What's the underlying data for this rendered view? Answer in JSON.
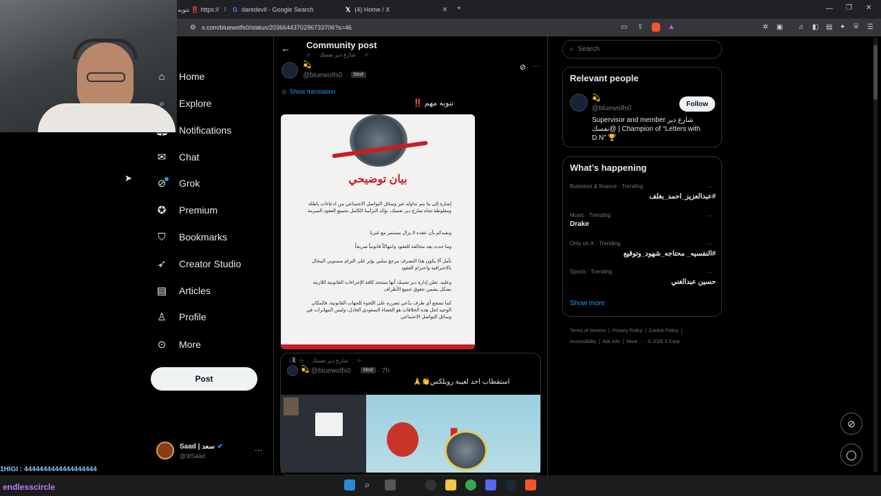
{
  "browser": {
    "tabs": [
      {
        "label": "تنويه ‼️ https://"
      },
      {
        "label": "daredevil - Google Search"
      },
      {
        "label": "(4) Home / X"
      }
    ],
    "url": "x.com/bluewolfs0/status/2036644370296733706?s=46"
  },
  "nav": {
    "items": [
      {
        "label": "Home",
        "icon": "home-icon"
      },
      {
        "label": "Explore",
        "icon": "search-icon"
      },
      {
        "label": "Notifications",
        "icon": "bell-icon"
      },
      {
        "label": "Chat",
        "icon": "mail-icon"
      },
      {
        "label": "Grok",
        "icon": "grok-icon"
      },
      {
        "label": "Premium",
        "icon": "verified-icon"
      },
      {
        "label": "Bookmarks",
        "icon": "bookmark-icon"
      },
      {
        "label": "Creator Studio",
        "icon": "rocket-icon"
      },
      {
        "label": "Articles",
        "icon": "article-icon"
      },
      {
        "label": "Profile",
        "icon": "person-icon"
      },
      {
        "label": "More",
        "icon": "more-circle-icon"
      }
    ],
    "post_label": "Post",
    "account": {
      "name": "Saad | سعد",
      "handle": "@9lSaad"
    }
  },
  "header": {
    "title": "Community post",
    "subtitle": "⊹ ﹒ شارع دير نفسك ﹒ ⊹"
  },
  "post": {
    "author_emoji": "💫",
    "handle": "@bluewolfs0",
    "mod": "Mod",
    "show_translation": "Show translation",
    "text": "تنويه مهم ‼️",
    "image_title": "بيان توضيحي",
    "image_paragraphs": [
      "إشارة إلى ما يتم تداوله عبر وسائل التواصل الاجتماعي من ادعاءات باطلة ومغلوطة تجاه شارع دير نفسك، نؤكد التزامنا الكامل بجميع العقود المبرمة",
      "ونفيدكم بأن عقده لا يزال مستمر مع غيرنا",
      "وما حدث يعد مخالفة للعقود وانتهاكاً قانونياً صريحاً",
      "نأمل ألا يكون هذا التصرف مرجع سلبي يؤثر على التزام منسوبي المجال بالاحترافية واحترام العقود",
      "وعليه، تعلن إدارة دير نفسك أنها ستتخذ كافة الإجراءات القانونية اللازمة بشكل يضمن حقوق جميع الأطراف",
      "كما نشجع أي طرف يدّعي تضرره على اللجوء للجهات القانونية، فالمكان الوحيد لحل هذه الخلافات هو القضاء السعودي العادل، وليس المهاترات في وسائل التواصل الاجتماعي"
    ]
  },
  "post2": {
    "community": "⊹ ﹒ شارع دير نفسك ﹒ ⊹",
    "handle": "@bluewolfs0",
    "mod": "Mod",
    "time": "7h",
    "text": "استقطاب احد لعيبة روبلكس👏🙏"
  },
  "right": {
    "search_placeholder": "Search",
    "relevant_title": "Relevant people",
    "person": {
      "emoji": "💫",
      "handle": "@bluewolfs0",
      "follow": "Follow",
      "bio": "Supervisor and member شارع دير نفسك@ | Champion of “Letters with D.N” 🏆"
    },
    "happening_title": "What’s happening",
    "trends": [
      {
        "category": "Business & finance · Trending",
        "name": "#عبدالعزيز_احمد_بغلف"
      },
      {
        "category": "Music · Trending",
        "name": "Drake"
      },
      {
        "category": "Only on X · Trending",
        "name": "#النفسيه_ محتاجه_شهود_وتوقيع"
      },
      {
        "category": "Sports · Trending",
        "name": "حسين عبدالغني"
      }
    ],
    "show_more": "Show more",
    "footer": [
      "Terms of Service",
      "Privacy Policy",
      "Cookie Policy",
      "Accessibility",
      "Ads info",
      "More ···",
      "© 2026 X Corp."
    ]
  },
  "chat_overlay": {
    "line1": "1HIGI : 4444444444444444444",
    "line2": "endlesscircle"
  },
  "colors": {
    "accent": "#1d9bf0",
    "background": "#000000",
    "border": "#2f3336",
    "muted": "#71767b"
  }
}
